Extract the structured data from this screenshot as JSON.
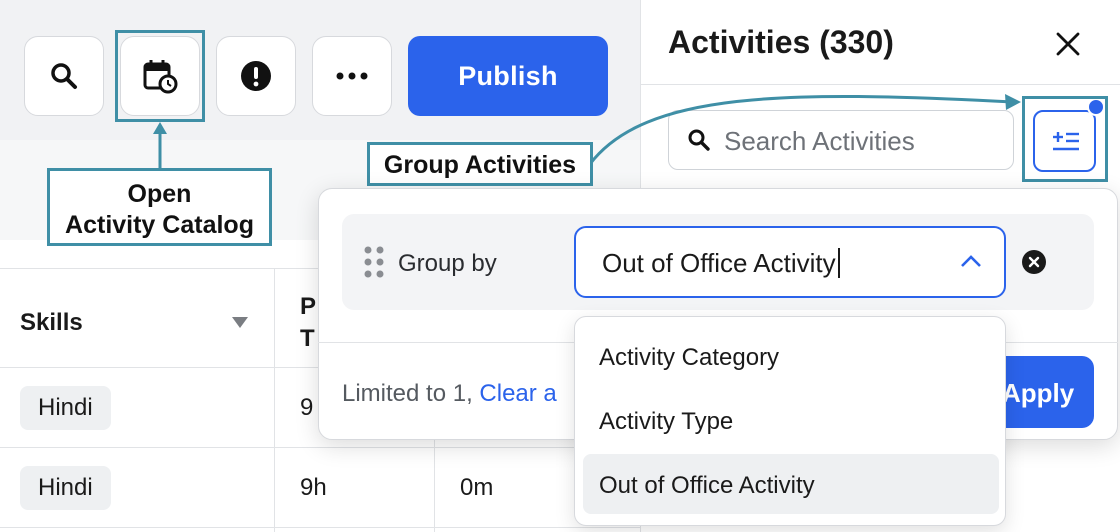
{
  "toolbar": {
    "buttons": [
      {
        "icon": "search-icon"
      },
      {
        "icon": "calendar-clock-icon"
      },
      {
        "icon": "alert-icon"
      },
      {
        "icon": "more-icon"
      }
    ],
    "publish_label": "Publish"
  },
  "annotations": {
    "open_catalog": "Open\nActivity Catalog",
    "group_activities": "Group Activities"
  },
  "table": {
    "headers": {
      "skills": "Skills",
      "col2": "P\nT"
    },
    "rows": [
      {
        "skill": "Hindi",
        "col2": "9",
        "col3": ""
      },
      {
        "skill": "Hindi",
        "col2": "9h",
        "col3": "0m"
      }
    ]
  },
  "panel": {
    "title": "Activities (330)",
    "search_placeholder": "Search Activities"
  },
  "group_by": {
    "label": "Group by",
    "selected": "Out of Office Activity",
    "options": [
      "Activity Category",
      "Activity Type",
      "Out of Office Activity"
    ],
    "limit_text": "Limited to 1,",
    "clear_text": "Clear a",
    "apply_label": "Apply"
  },
  "colors": {
    "accent": "#2b63eb",
    "callout": "#3f8fa6"
  }
}
